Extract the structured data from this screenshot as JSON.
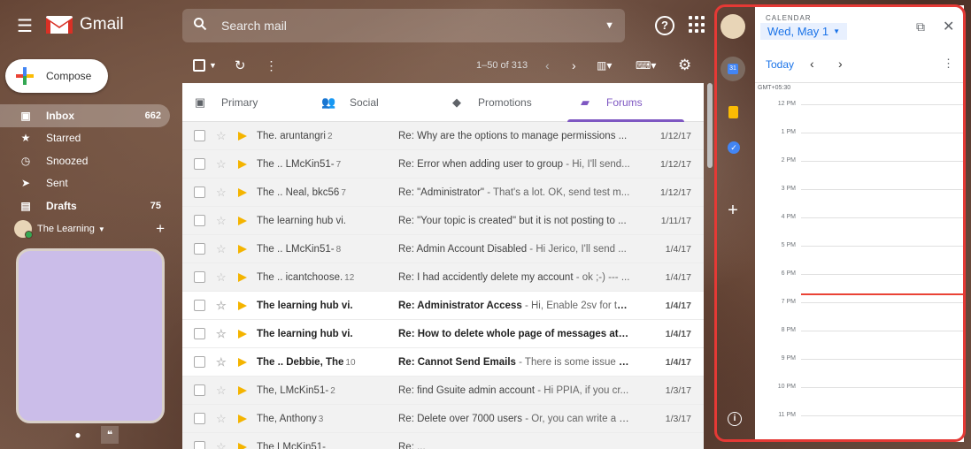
{
  "header": {
    "app_name": "Gmail",
    "search_placeholder": "Search mail"
  },
  "compose": {
    "label": "Compose"
  },
  "sidebar": {
    "items": [
      {
        "label": "Inbox",
        "count": "662",
        "icon": "inbox-icon"
      },
      {
        "label": "Starred",
        "count": "",
        "icon": "star-icon"
      },
      {
        "label": "Snoozed",
        "count": "",
        "icon": "clock-icon"
      },
      {
        "label": "Sent",
        "count": "",
        "icon": "send-icon"
      },
      {
        "label": "Drafts",
        "count": "75",
        "icon": "draft-icon"
      }
    ],
    "hangouts_user": "The Learning"
  },
  "toolbar": {
    "range": "1–50 of 313"
  },
  "tabs": [
    {
      "label": "Primary",
      "icon": "inbox-icon"
    },
    {
      "label": "Social",
      "icon": "people-icon"
    },
    {
      "label": "Promotions",
      "icon": "tag-icon"
    },
    {
      "label": "Forums",
      "icon": "forum-icon",
      "selected": true
    }
  ],
  "emails": [
    {
      "from": "The. aruntangri",
      "count": "2",
      "subject": "Re: Why are the options to manage permissions ...",
      "snippet": "",
      "date": "1/12/17",
      "unread": false
    },
    {
      "from": "The .. LMcKin51-",
      "count": "7",
      "subject": "Re: Error when adding user to group",
      "snippet": " - Hi, I'll send...",
      "date": "1/12/17",
      "unread": false
    },
    {
      "from": "The .. Neal, bkc56",
      "count": "7",
      "subject": "Re: \"Administrator\"",
      "snippet": " - That's a lot. OK, send test m...",
      "date": "1/12/17",
      "unread": false
    },
    {
      "from": "The learning hub vi.",
      "count": "",
      "subject": "Re: \"Your topic is created\" but it is not posting to ...",
      "snippet": "",
      "date": "1/11/17",
      "unread": false
    },
    {
      "from": "The .. LMcKin51-",
      "count": "8",
      "subject": "Re: Admin Account Disabled",
      "snippet": " - Hi Jerico, I'll send ...",
      "date": "1/4/17",
      "unread": false
    },
    {
      "from": "The .. icantchoose.",
      "count": "12",
      "subject": "Re: I had accidently delete my account",
      "snippet": " - ok ;-) --- ...",
      "date": "1/4/17",
      "unread": false
    },
    {
      "from": "The learning hub vi.",
      "count": "",
      "subject": "Re: Administrator Access",
      "snippet": " - Hi, Enable 2sv for tho...",
      "date": "1/4/17",
      "unread": true
    },
    {
      "from": "The learning hub vi.",
      "count": "",
      "subject": "Re: How to delete whole page of messages at o...",
      "snippet": "",
      "date": "1/4/17",
      "unread": true
    },
    {
      "from": "The .. Debbie, The",
      "count": "10",
      "subject": "Re: Cannot Send Emails",
      "snippet": " - There is some issue wi...",
      "date": "1/4/17",
      "unread": true
    },
    {
      "from": "The, LMcKin51-",
      "count": "2",
      "subject": "Re: find Gsuite admin account",
      "snippet": " - Hi PPIA, if you cr...",
      "date": "1/3/17",
      "unread": false
    },
    {
      "from": "The, Anthony",
      "count": "3",
      "subject": "Re: Delete over 7000 users",
      "snippet": " - Or, you can write a g...",
      "date": "1/3/17",
      "unread": false
    },
    {
      "from": "The LMcKin51-",
      "count": "",
      "subject": "Re: ...",
      "snippet": "",
      "date": "",
      "unread": false
    }
  ],
  "calendar": {
    "label": "CALENDAR",
    "date": "Wed, May 1",
    "today": "Today",
    "timezone": "GMT+05:30",
    "hours": [
      "12 PM",
      "1 PM",
      "2 PM",
      "3 PM",
      "4 PM",
      "5 PM",
      "6 PM",
      "7 PM",
      "8 PM",
      "9 PM",
      "10 PM",
      "11 PM"
    ]
  },
  "colors": {
    "accent": "#7e57c2",
    "calendar_blue": "#1a73e8",
    "highlight_box": "#e53935",
    "current_time": "#ea4335"
  }
}
